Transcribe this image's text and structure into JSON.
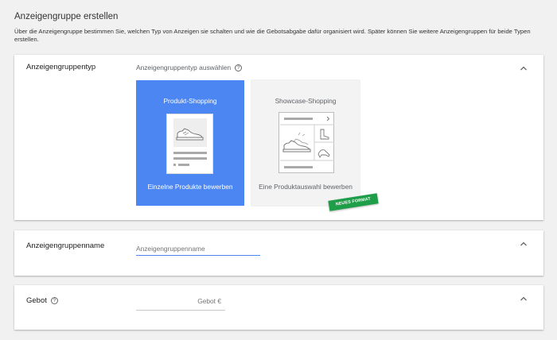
{
  "header": {
    "title": "Anzeigengruppe erstellen",
    "description": "Über die Anzeigengruppe bestimmen Sie, welchen Typ von Anzeigen sie schalten und wie die Gebotsabgabe dafür organisiert wird. Später können Sie weitere Anzeigengruppen für beide Typen erstellen."
  },
  "type_section": {
    "label": "Anzeigengruppentyp",
    "prompt": "Anzeigengruppentyp auswählen",
    "options": [
      {
        "title": "Produkt-Shopping",
        "footer": "Einzelne Produkte bewerben",
        "selected": true,
        "color": "#4c86f2"
      },
      {
        "title": "Showcase-Shopping",
        "footer": "Eine Produktauswahl bewerben",
        "selected": false,
        "badge": "NEUES FORMAT",
        "badge_color": "#1e9e48"
      }
    ]
  },
  "name_section": {
    "label": "Anzeigengruppenname",
    "placeholder": "Anzeigengruppenname"
  },
  "bid_section": {
    "label": "Gebot",
    "field_text": "Gebot €"
  },
  "icons": {
    "help": "help-circle-icon",
    "collapse": "chevron-up-icon"
  }
}
